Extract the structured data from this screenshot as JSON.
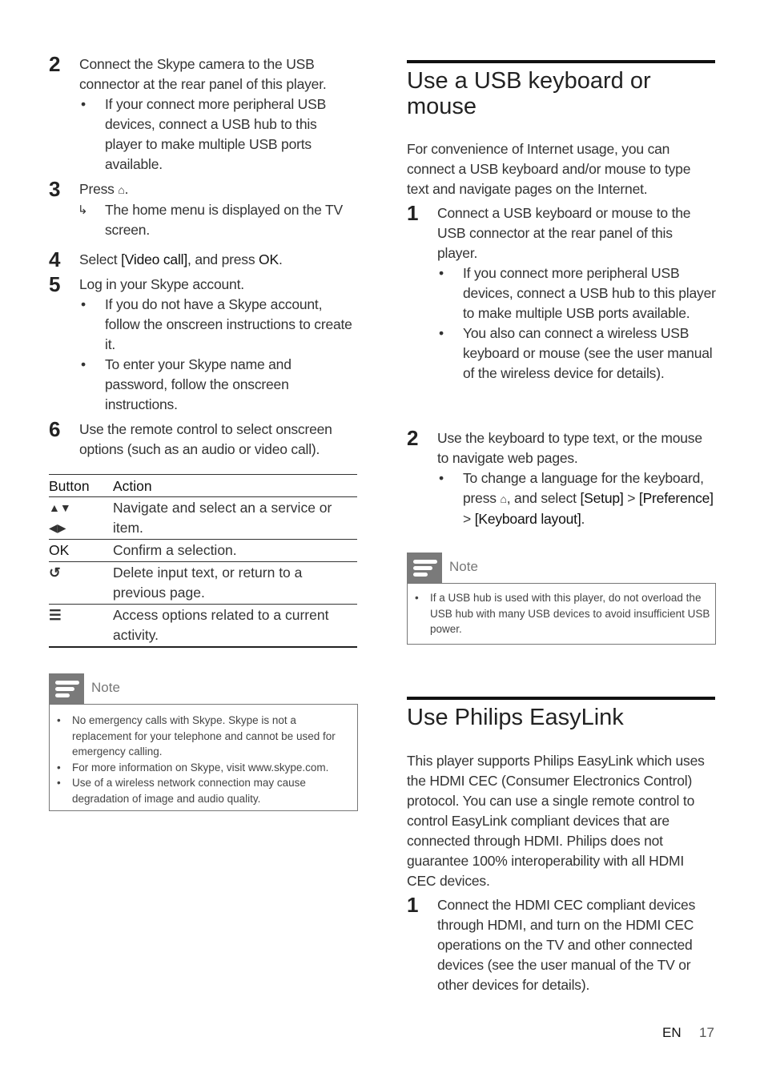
{
  "left": {
    "steps": [
      {
        "num": "2",
        "text": "Connect the Skype camera to the USB connector at the rear panel of this player.",
        "bullets": [
          "If your connect more peripheral USB devices, connect a USB hub to this player to make multiple USB ports available."
        ]
      },
      {
        "num": "3",
        "text_pre": "Press ",
        "icon": "home-icon",
        "text_post": ".",
        "result": "The home menu is displayed on the TV screen."
      },
      {
        "num": "4",
        "text_pre": "Select ",
        "kw1": "[Video call]",
        "text_mid": ", and press ",
        "kw2": "OK",
        "text_post": "."
      },
      {
        "num": "5",
        "text": "Log in your Skype account.",
        "bullets": [
          "If you do not have a Skype account, follow the onscreen instructions to create it.",
          "To enter your Skype name and password, follow the onscreen instructions."
        ]
      },
      {
        "num": "6",
        "text": "Use the remote control to select onscreen options (such as an audio or video call)."
      }
    ],
    "table": {
      "headers": [
        "Button",
        "Action"
      ],
      "rows": [
        {
          "button": "▲▼ ◀▶",
          "button_icon": "navigation-arrows-icon",
          "action": "Navigate and select an a service or item."
        },
        {
          "button": "OK",
          "action": "Confirm a selection."
        },
        {
          "button": "⮌",
          "button_icon": "back-icon",
          "action": "Delete input text, or return to a previous page."
        },
        {
          "button": "☰",
          "button_icon": "options-icon",
          "action": "Access options related to a current activity."
        }
      ]
    },
    "note": {
      "label": "Note",
      "items": [
        "No emergency calls with Skype. Skype is not a replacement for your telephone and cannot be used for emergency calling.",
        "For more information on Skype, visit www.skype.com.",
        "Use of a wireless network connection may cause degradation of image and audio quality."
      ]
    }
  },
  "right": {
    "section1": {
      "title": "Use a USB keyboard or mouse",
      "intro": "For convenience of Internet usage, you can connect a USB keyboard and/or mouse to type text and navigate pages on the Internet.",
      "steps": [
        {
          "num": "1",
          "text": "Connect a USB keyboard or mouse to the USB connector at the rear panel of this player.",
          "bullets": [
            "If you connect more peripheral USB devices, connect a USB hub to this player to make multiple USB ports available.",
            "You also can connect a wireless USB keyboard or mouse (see the user manual of the wireless device for details)."
          ]
        },
        {
          "num": "2",
          "text": "Use the keyboard to type text, or the mouse to navigate web pages.",
          "bullet": {
            "pre": "To change a language for the keyboard, press ",
            "mid": ", and select ",
            "kw1": "[Setup]",
            "sep1": " > ",
            "kw2": "[Preference]",
            "sep2": " > ",
            "kw3": "[Keyboard layout]",
            "post": "."
          }
        }
      ],
      "note": {
        "label": "Note",
        "items": [
          "If a USB hub is used with this player, do not overload the USB hub with many USB devices to avoid insufficient USB power."
        ]
      }
    },
    "section2": {
      "title": "Use Philips EasyLink",
      "intro": "This player supports Philips EasyLink which uses the HDMI CEC (Consumer Electronics Control) protocol. You can use a single remote control to control EasyLink compliant devices that are connected through HDMI. Philips does not guarantee 100% interoperability with all HDMI CEC devices.",
      "steps": [
        {
          "num": "1",
          "text": "Connect the HDMI CEC compliant devices through HDMI, and turn on the HDMI CEC operations on the TV and other connected devices (see the user manual of the TV or other devices for details)."
        }
      ]
    }
  },
  "footer": {
    "lang": "EN",
    "page": "17"
  }
}
